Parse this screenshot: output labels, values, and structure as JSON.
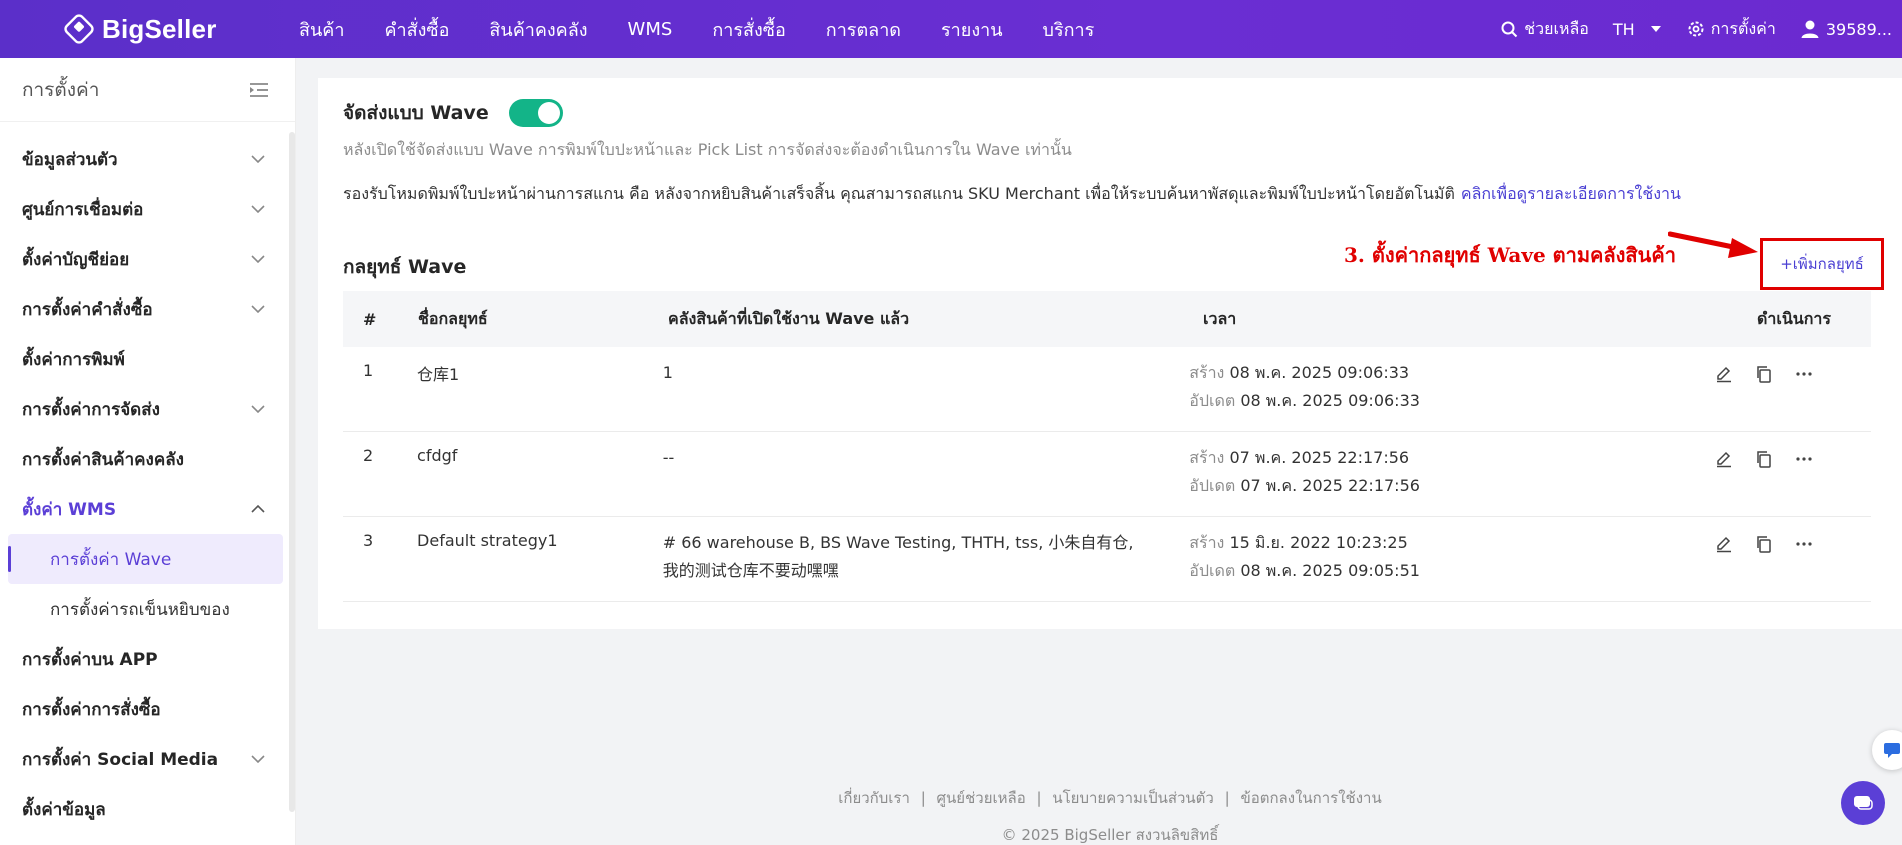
{
  "brand": {
    "name": "BigSeller"
  },
  "nav": [
    "สินค้า",
    "คำสั่งซื้อ",
    "สินค้าคงคลัง",
    "WMS",
    "การสั่งซื้อ",
    "การตลาด",
    "รายงาน",
    "บริการ"
  ],
  "top_right": {
    "help": "ช่วยเหลือ",
    "language": "TH",
    "settings": "การตั้งค่า",
    "user": "39589..."
  },
  "sidebar": {
    "title": "การตั้งค่า",
    "items": [
      {
        "label": "ข้อมูลส่วนตัว"
      },
      {
        "label": "ศูนย์การเชื่อมต่อ"
      },
      {
        "label": "ตั้งค่าบัญชีย่อย"
      },
      {
        "label": "การตั้งค่าคำสั่งซื้อ"
      },
      {
        "label": "ตั้งค่าการพิมพ์"
      },
      {
        "label": "การตั้งค่าการจัดส่ง"
      },
      {
        "label": "การตั้งค่าสินค้าคงคลัง"
      },
      {
        "label": "ตั้งค่า WMS"
      },
      {
        "label": "การตั้งค่า Wave"
      },
      {
        "label": "การตั้งค่ารถเข็นหยิบของ"
      },
      {
        "label": "การตั้งค่าบน APP"
      },
      {
        "label": "การตั้งค่าการสั่งซื้อ"
      },
      {
        "label": "การตั้งค่า Social Media"
      },
      {
        "label": "ตั้งค่าข้อมูล"
      }
    ]
  },
  "wave": {
    "title": "จัดส่งแบบ Wave",
    "hint": "หลังเปิดใช้จัดส่งแบบ Wave การพิมพ์ใบปะหน้าและ Pick List การจัดส่งจะต้องดำเนินการใน Wave เท่านั้น",
    "desc": "รองรับโหมดพิมพ์ใบปะหน้าผ่านการสแกน คือ หลังจากหยิบสินค้าเสร็จสิ้น คุณสามารถสแกน SKU Merchant เพื่อให้ระบบค้นหาพัสดุและพิมพ์ใบปะหน้าโดยอัตโนมัติ",
    "desc_link": "คลิกเพื่อดูรายละเอียดการใช้งาน",
    "section_title": "กลยุทธ์ Wave",
    "annotation": "3. ตั้งค่ากลยุทธ์ Wave ตามคลังสินค้า",
    "add_button": "+เพิ่มกลยุทธ์"
  },
  "table": {
    "headers": {
      "num": "#",
      "name": "ชื่อกลยุทธ์",
      "warehouses": "คลังสินค้าที่เปิดใช้งาน Wave แล้ว",
      "time": "เวลา",
      "actions": "ดำเนินการ"
    },
    "created_label": "สร้าง",
    "updated_label": "อัปเดต",
    "rows": [
      {
        "num": "1",
        "name": "仓库1",
        "warehouses": "1",
        "created": "08 พ.ค. 2025 09:06:33",
        "updated": "08 พ.ค. 2025 09:06:33"
      },
      {
        "num": "2",
        "name": "cfdgf",
        "warehouses": "--",
        "created": "07 พ.ค. 2025 22:17:56",
        "updated": "07 พ.ค. 2025 22:17:56"
      },
      {
        "num": "3",
        "name": "Default strategy1",
        "warehouses": "# 66 warehouse B, BS Wave Testing, THTH, tss, 小朱自有仓, 我的测试仓库不要动嘿嘿",
        "created": "15 มิ.ย. 2022 10:23:25",
        "updated": "08 พ.ค. 2025 09:05:51"
      }
    ]
  },
  "footer": {
    "links": [
      "เกี่ยวกับเรา",
      "ศูนย์ช่วยเหลือ",
      "นโยบายความเป็นส่วนตัว",
      "ข้อตกลงในการใช้งาน"
    ],
    "separator": "|",
    "copyright": "© 2025 BigSeller สงวนลิขสิทธิ์"
  },
  "colors": {
    "accent": "#5b3fd6",
    "toggle_on": "#13b488",
    "annotation": "#e00000"
  }
}
